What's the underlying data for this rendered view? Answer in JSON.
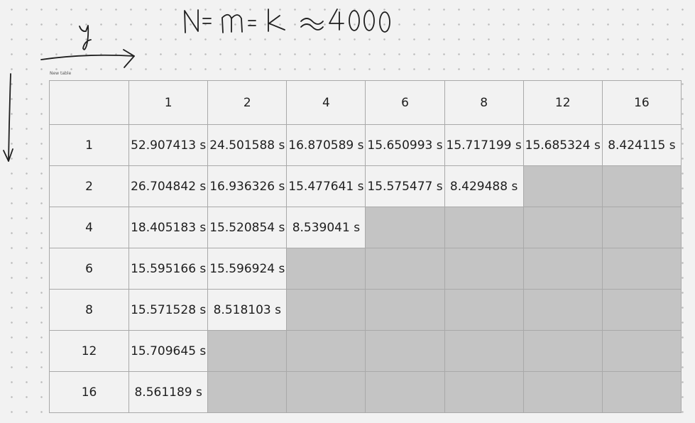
{
  "annotation": {
    "formula": "N = m = k ≈ 4000",
    "x_axis_label": "y"
  },
  "table": {
    "caption": "New table",
    "corner": "",
    "column_headers": [
      "1",
      "2",
      "4",
      "6",
      "8",
      "12",
      "16"
    ],
    "rows": [
      {
        "header": "1",
        "cells": [
          "52.907413 s",
          "24.501588 s",
          "16.870589 s",
          "15.650993 s",
          "15.717199 s",
          "15.685324 s",
          "8.424115 s"
        ]
      },
      {
        "header": "2",
        "cells": [
          "26.704842 s",
          "16.936326 s",
          "15.477641 s",
          "15.575477 s",
          "8.429488 s",
          "",
          ""
        ]
      },
      {
        "header": "4",
        "cells": [
          "18.405183 s",
          "15.520854 s",
          "8.539041 s",
          "",
          "",
          "",
          ""
        ]
      },
      {
        "header": "6",
        "cells": [
          "15.595166 s",
          "15.596924 s",
          "",
          "",
          "",
          "",
          ""
        ]
      },
      {
        "header": "8",
        "cells": [
          "15.571528 s",
          "8.518103 s",
          "",
          "",
          "",
          "",
          ""
        ]
      },
      {
        "header": "12",
        "cells": [
          "15.709645 s",
          "",
          "",
          "",
          "",
          "",
          ""
        ]
      },
      {
        "header": "16",
        "cells": [
          "8.561189 s",
          "",
          "",
          "",
          "",
          "",
          ""
        ]
      }
    ],
    "colors": {
      "cell_background": "#f2f2f2",
      "empty_cell_background": "#c4c4c4",
      "border": "#a9a9a9",
      "ink": "#1e1e1e"
    }
  }
}
